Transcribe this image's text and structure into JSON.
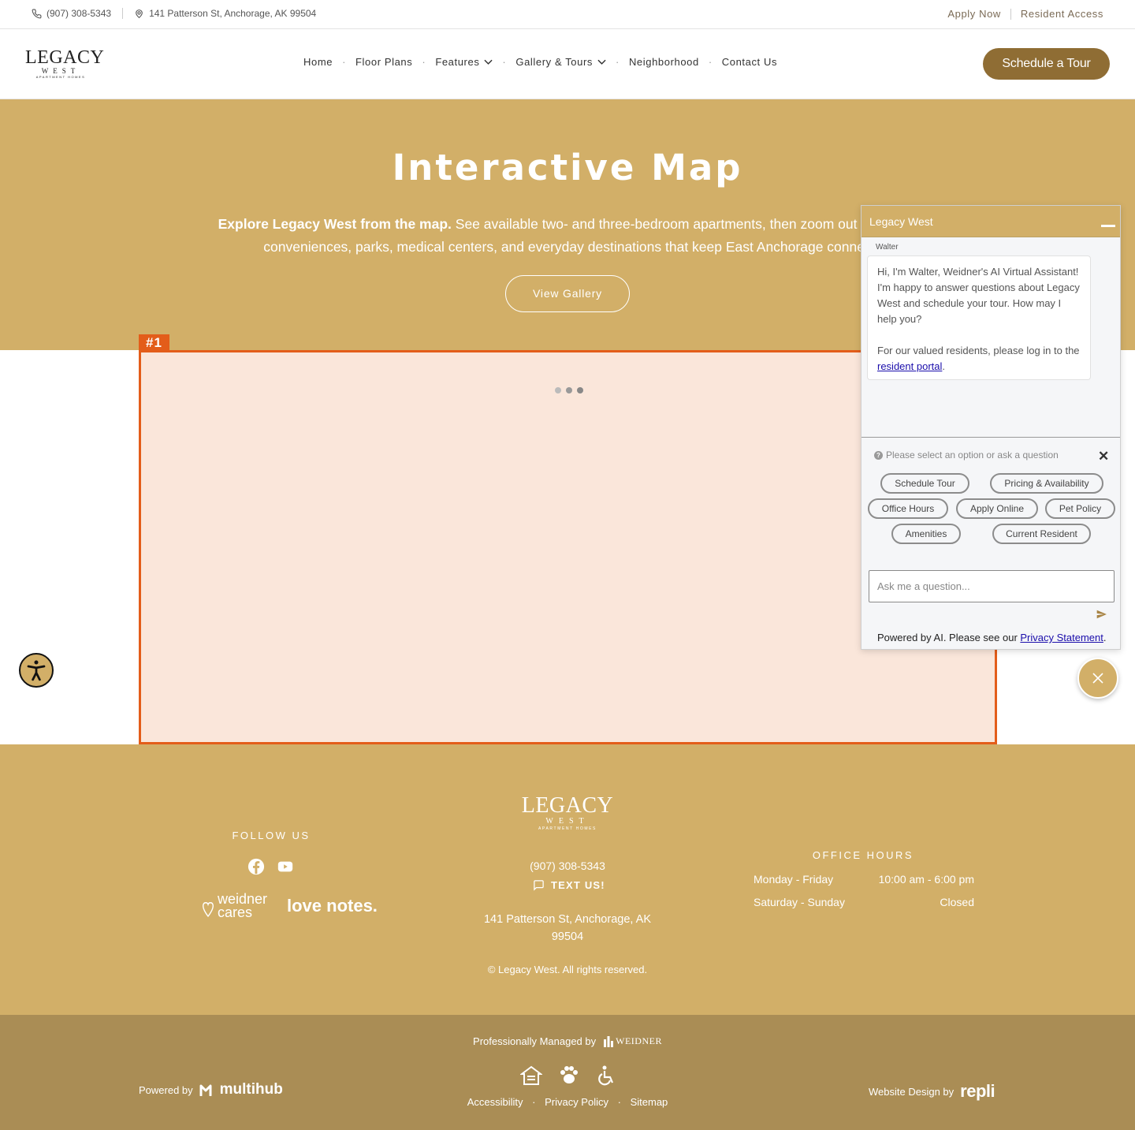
{
  "topbar": {
    "phone": "(907) 308-5343",
    "address": "141 Patterson St, Anchorage, AK 99504",
    "apply_label": "Apply Now",
    "resident_label": "Resident Access"
  },
  "header": {
    "logo_main": "LEGACY",
    "logo_sub": "WEST",
    "logo_tagline": "APARTMENT HOMES",
    "nav": [
      "Home",
      "Floor Plans",
      "Features",
      "Gallery & Tours",
      "Neighborhood",
      "Contact Us"
    ],
    "cta_label": "Schedule a Tour"
  },
  "hero": {
    "title": "Interactive Map",
    "lead_bold": "Explore Legacy West from the map.",
    "lead_line1_rest": " See available two- and three-bedroom apartments, then zoom out to the No",
    "lead_line2": "conveniences, parks, medical centers, and everyday destinations that keep East Anchorage connec",
    "gallery_label": "View Gallery"
  },
  "map": {
    "tag": "#1"
  },
  "chat": {
    "title": "Legacy West",
    "agent": "Walter",
    "message_p1": "Hi, I'm Walter, Weidner's AI Virtual Assistant! I'm happy to answer questions about Legacy West and schedule your tour. How may I help you?",
    "message_p2": "For our valued residents, please log in to the",
    "message_link": "resident portal",
    "message_end": ".",
    "hint": "Please select an option or ask a question",
    "options": [
      "Schedule Tour",
      "Pricing & Availability",
      "Office Hours",
      "Apply Online",
      "Pet Policy",
      "Amenities",
      "Current Resident"
    ],
    "input_placeholder": "Ask me a question...",
    "powered_text": "Powered by AI. Please see our ",
    "powered_link": "Privacy Statement",
    "powered_end": "."
  },
  "footer": {
    "follow_label": "FOLLOW US",
    "cares_label": "weidner cares",
    "love_label": "love notes.",
    "logo_main": "LEGACY",
    "logo_sub": "WEST",
    "logo_tagline": "APARTMENT HOMES",
    "phone": "(907) 308-5343",
    "text_label": "TEXT US!",
    "address": "141 Patterson St, Anchorage, AK 99504",
    "copyright": "© Legacy West. All rights reserved.",
    "hours_title": "OFFICE HOURS",
    "hours": [
      {
        "days": "Monday - Friday",
        "time": "10:00 am - 6:00 pm"
      },
      {
        "days": "Saturday - Sunday",
        "time": "Closed"
      }
    ]
  },
  "bottom": {
    "managed_label": "Professionally Managed by",
    "managed_brand": "WEIDNER",
    "links": [
      "Accessibility",
      "Privacy Policy",
      "Sitemap"
    ],
    "powered_label": "Powered by",
    "powered_brand": "multihub",
    "design_label": "Website Design by",
    "design_brand": "repli"
  },
  "colors": {
    "gold": "#d2af68",
    "dark_gold": "#8f6d34",
    "bottom_bar": "#aa8d55",
    "highlight": "#e35d1a"
  }
}
